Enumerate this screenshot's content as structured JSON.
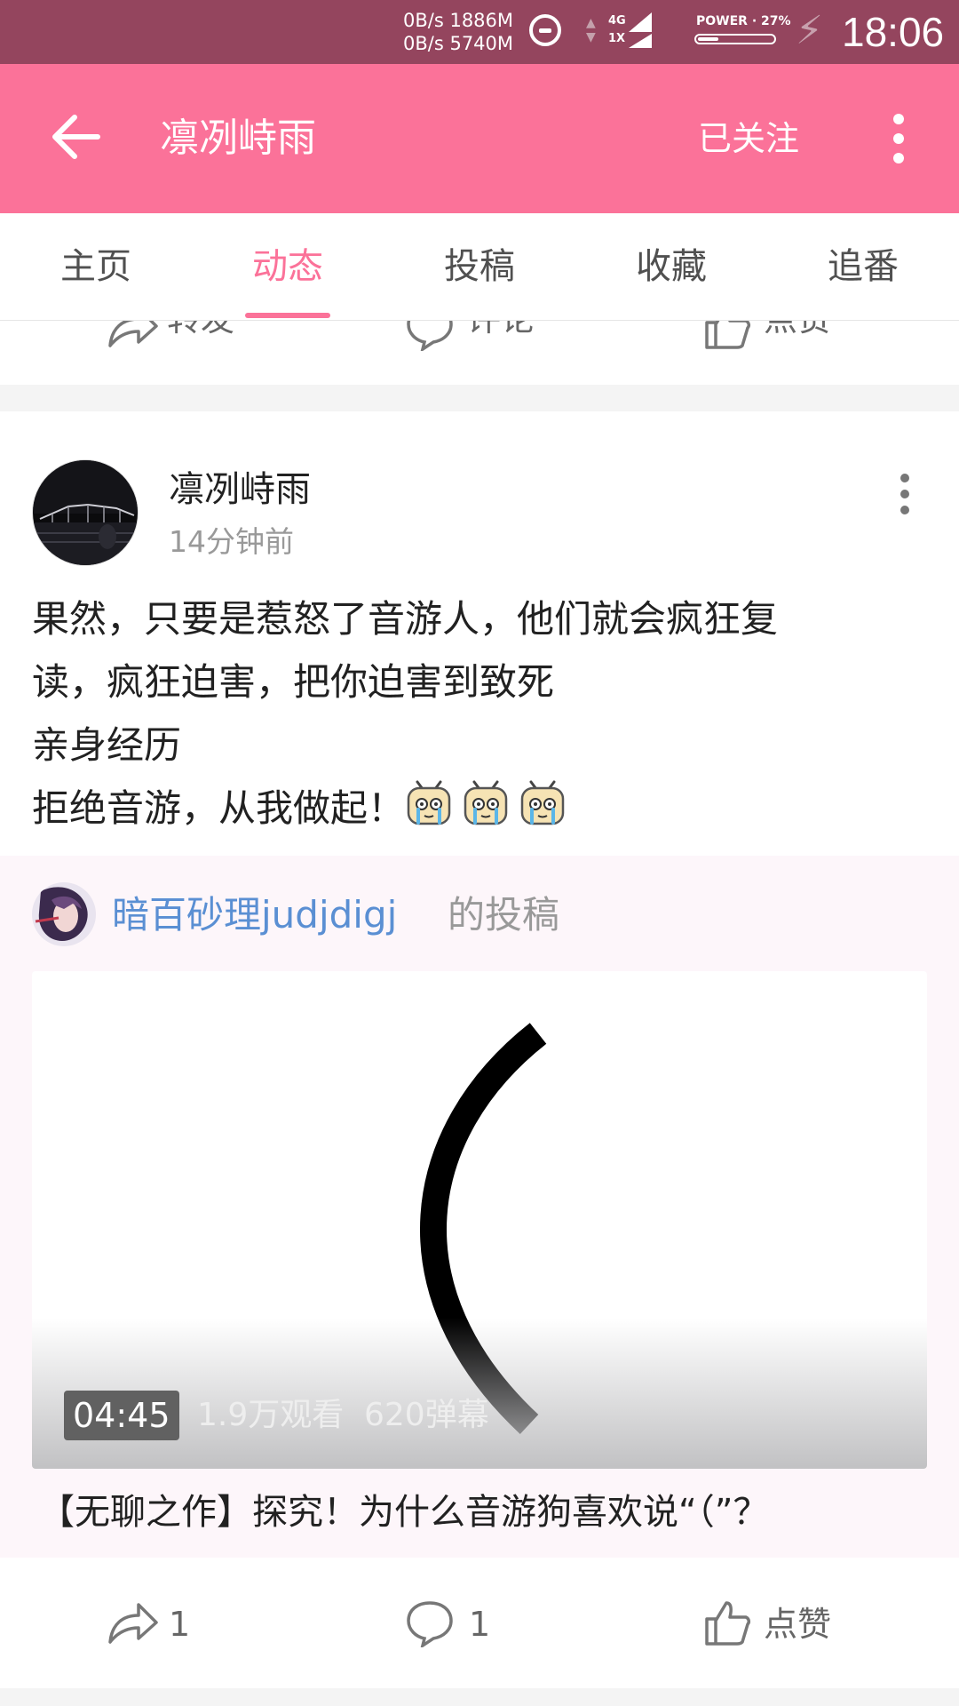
{
  "status_bar": {
    "net_up": "0B/s 1886M",
    "net_down": "0B/s 5740M",
    "network_type": "4G",
    "sim2_label": "1X",
    "power_label": "POWER · 27%",
    "battery_level": 0.27,
    "time": "18:06"
  },
  "toolbar": {
    "title": "凛冽峙雨",
    "follow_label": "已关注",
    "back_icon": "arrow-left-icon",
    "more_icon": "more-vertical-icon"
  },
  "tabs": [
    {
      "label": "主页",
      "active": false
    },
    {
      "label": "动态",
      "active": true
    },
    {
      "label": "投稿",
      "active": false
    },
    {
      "label": "收藏",
      "active": false
    },
    {
      "label": "追番",
      "active": false
    }
  ],
  "prev_card": {
    "share_label": "转发",
    "comment_label": "评论",
    "like_label": "点赞"
  },
  "post": {
    "author": "凛冽峙雨",
    "time": "14分钟前",
    "content_lines": [
      "果然，只要是惹怒了音游人，他们就会疯狂复",
      "读，疯狂迫害，把你迫害到致死",
      "亲身经历",
      "拒绝音游，从我做起！"
    ],
    "emoji_count": 3,
    "repost": {
      "uploader": "暗百砂理judjdigj",
      "suffix": "的投稿",
      "duration": "04:45",
      "views": "1.9万观看",
      "danmaku": "620弹幕",
      "video_title": "【无聊之作】探究！为什么音游狗喜欢说“（”？"
    },
    "actions": {
      "share_count": "1",
      "comment_count": "1",
      "like_label": "点赞"
    }
  },
  "colors": {
    "status_bar": "#94455e",
    "accent": "#fb7299",
    "link": "#5a8fd3"
  }
}
